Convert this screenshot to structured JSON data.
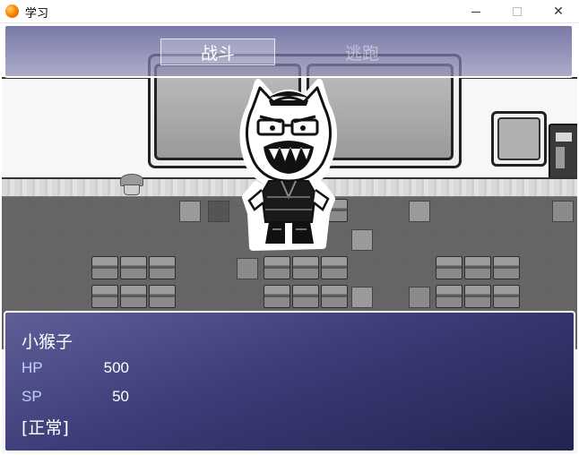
{
  "window": {
    "title": "学习",
    "icon": "app-orb-icon",
    "controls": [
      "minimize-icon",
      "maximize-icon",
      "close-icon"
    ],
    "close_glyph": "✕"
  },
  "battle": {
    "commands": [
      {
        "label": "战斗",
        "selected": true
      },
      {
        "label": "逃跑",
        "selected": false
      }
    ],
    "enemy_icon": "cat-monster-sprite"
  },
  "status": {
    "name": "小猴子",
    "hp_label": "HP",
    "hp_value": "500",
    "sp_label": "SP",
    "sp_value": "50",
    "state": "[正常]"
  },
  "colors": {
    "window_top": "#5c5c96",
    "window_bottom": "#23234f",
    "label_blue": "#bfd2ff",
    "floor": "#666666"
  }
}
